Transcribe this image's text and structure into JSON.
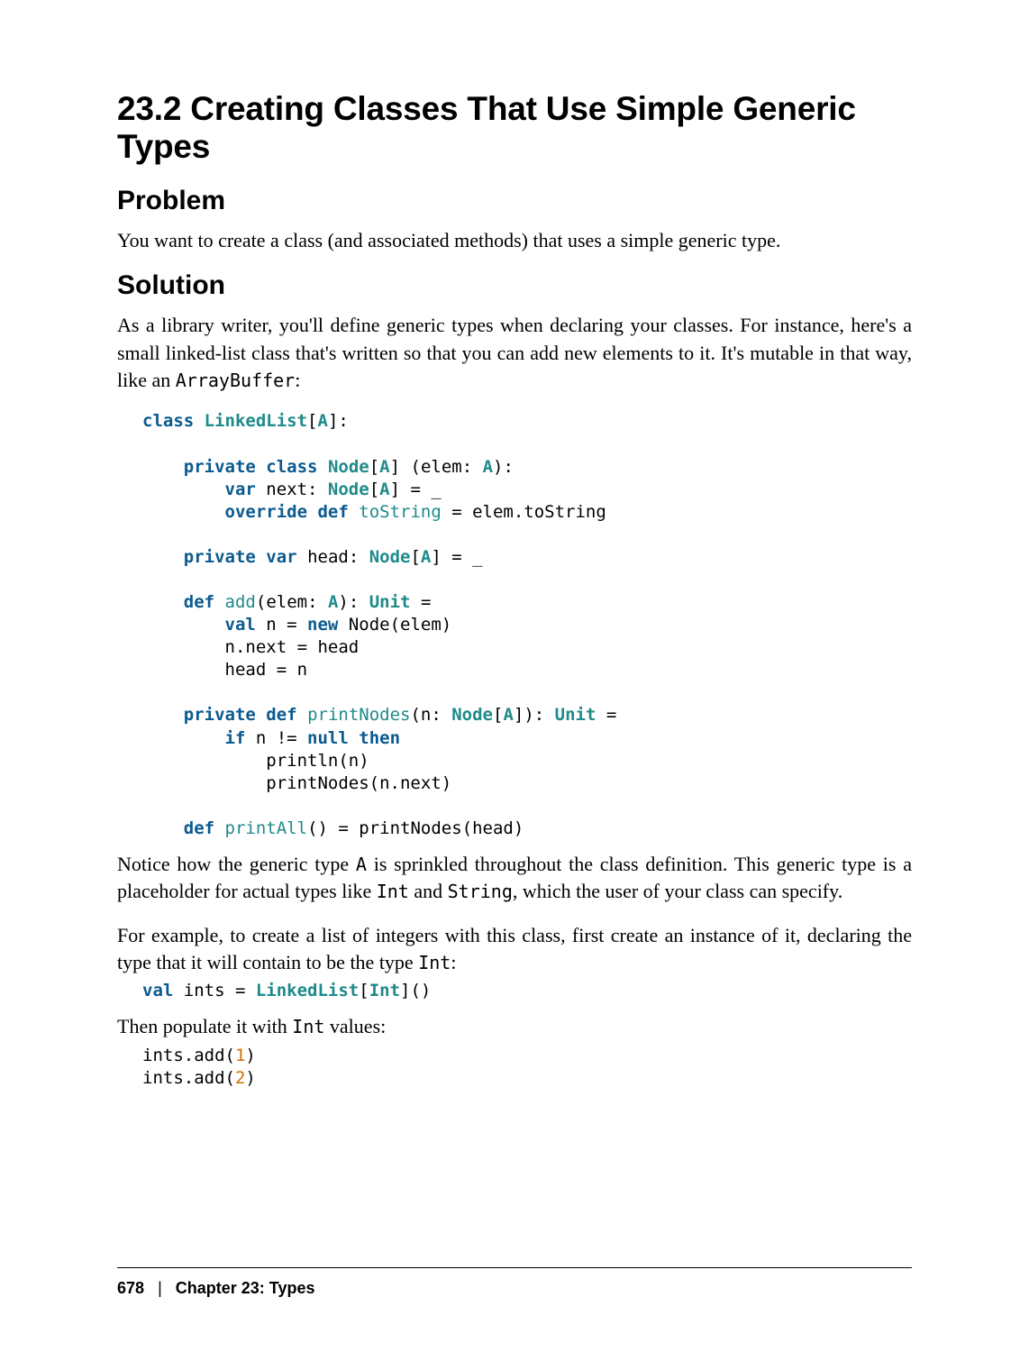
{
  "section_title": "23.2 Creating Classes That Use Simple Generic Types",
  "h_problem": "Problem",
  "p_problem": "You want to create a class (and associated methods) that uses a simple generic type.",
  "h_solution": "Solution",
  "p_solution_pre": "As a library writer, you'll define generic types when declaring your classes. For instance, here's a small linked-list class that's written so that you can add new elements to it. It's mutable in that way, like an ",
  "p_solution_code": "ArrayBuffer",
  "p_solution_post": ":",
  "code1": {
    "l01_kw1": "class",
    "l01_typ": "LinkedList",
    "l01_txt": "[",
    "l01_typ2": "A",
    "l01_txt2": "]:",
    "l02_kw1": "private",
    "l02_kw2": "class",
    "l02_typ": "Node",
    "l02_txt": "[",
    "l02_typ2": "A",
    "l02_txt2": "] (elem: ",
    "l02_typ3": "A",
    "l02_txt3": "):",
    "l03_kw1": "var",
    "l03_txt1": " next: ",
    "l03_typ": "Node",
    "l03_txt2": "[",
    "l03_typ2": "A",
    "l03_txt3": "] = _",
    "l04_kw1": "override",
    "l04_kw2": "def",
    "l04_fn": "toString",
    "l04_txt": " = elem.toString",
    "l05_kw1": "private",
    "l05_kw2": "var",
    "l05_txt1": " head: ",
    "l05_typ": "Node",
    "l05_txt2": "[",
    "l05_typ2": "A",
    "l05_txt3": "] = _",
    "l06_kw1": "def",
    "l06_fn": "add",
    "l06_txt1": "(elem: ",
    "l06_typ": "A",
    "l06_txt2": "): ",
    "l06_typ2": "Unit",
    "l06_txt3": " =",
    "l07_kw1": "val",
    "l07_txt1": " n = ",
    "l07_kw2": "new",
    "l07_txt2": " Node(elem)",
    "l08_txt": "n.next = head",
    "l09_txt": "head = n",
    "l10_kw1": "private",
    "l10_kw2": "def",
    "l10_fn": "printNodes",
    "l10_txt1": "(n: ",
    "l10_typ": "Node",
    "l10_txt2": "[",
    "l10_typ2": "A",
    "l10_txt3": "]): ",
    "l10_typ3": "Unit",
    "l10_txt4": " =",
    "l11_kw1": "if",
    "l11_txt1": " n != ",
    "l11_kw2": "null",
    "l11_kw3": "then",
    "l12_txt": "println(n)",
    "l13_txt": "printNodes(n.next)",
    "l14_kw1": "def",
    "l14_fn": "printAll",
    "l14_txt": "() = printNodes(head)"
  },
  "p_notice_pre": "Notice how the generic type ",
  "p_notice_A": "A",
  "p_notice_mid1": " is sprinkled throughout the class definition. This generic type is a placeholder for actual types like ",
  "p_notice_Int": "Int",
  "p_notice_mid2": " and ",
  "p_notice_String": "String",
  "p_notice_post": ", which the user of your class can specify.",
  "p_example_pre": "For example, to create a list of integers with this class, first create an instance of it, declaring the type that it will contain to be the type ",
  "p_example_Int": "Int",
  "p_example_post": ":",
  "code2": {
    "kw": "val",
    "txt1": " ints = ",
    "typ": "LinkedList",
    "txt2": "[",
    "typ2": "Int",
    "txt3": "]()"
  },
  "p_then_pre": "Then populate it with ",
  "p_then_Int": "Int",
  "p_then_post": " values:",
  "code3": {
    "l1_pre": "ints.add(",
    "l1_num": "1",
    "l1_post": ")",
    "l2_pre": "ints.add(",
    "l2_num": "2",
    "l2_post": ")"
  },
  "footer": {
    "page_number": "678",
    "separator": "|",
    "chapter": "Chapter 23: Types"
  }
}
